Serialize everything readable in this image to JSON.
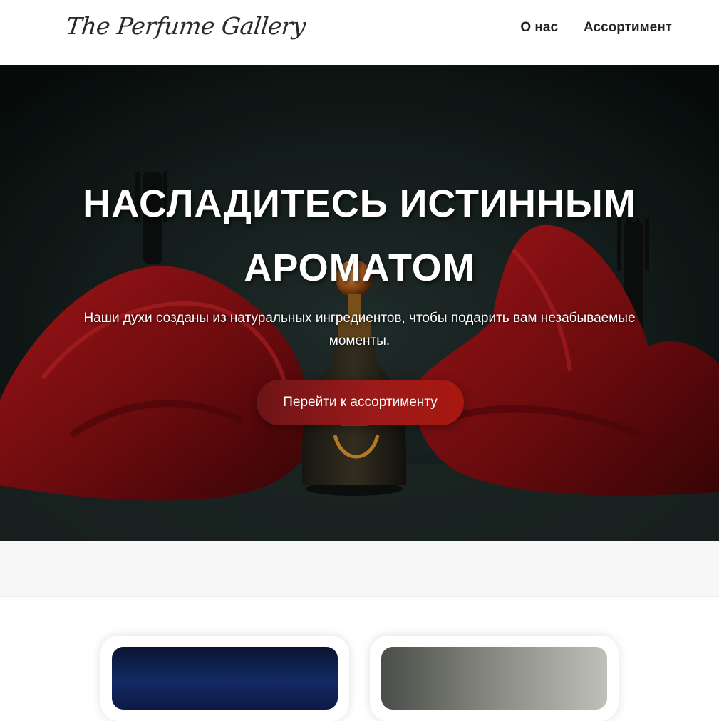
{
  "header": {
    "logo_text": "The Perfume Gallery",
    "nav": [
      {
        "label": "О нас"
      },
      {
        "label": "Ассортимент"
      }
    ]
  },
  "hero": {
    "title": "НАСЛАДИТЕСЬ ИСТИННЫМ АРОМАТОМ",
    "subtitle": "Наши духи созданы из натуральных ингредиентов, чтобы подарить вам незабываемые моменты.",
    "cta_label": "Перейти к ассортименту",
    "accent_color": "#9b1a1a"
  },
  "products": [
    {
      "image": "perfume-photo-blue"
    },
    {
      "image": "perfume-photo-grey"
    }
  ]
}
